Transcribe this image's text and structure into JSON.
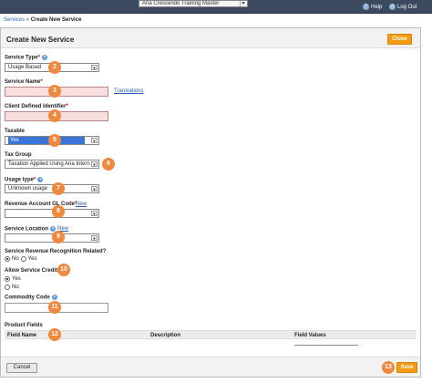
{
  "topbar": {
    "client_select": "Aria Crescendo Training Master",
    "help_label": "Help",
    "logout_label": "Log Out"
  },
  "breadcrumb": {
    "parent": "Services",
    "separator": "»",
    "current": "Create New Service"
  },
  "panel": {
    "title": "Create New Service",
    "close_label": "Close"
  },
  "form": {
    "service_type": {
      "label": "Service Type",
      "value": "Usage Based"
    },
    "service_name": {
      "label": "Service Name",
      "translations_link": "Translations",
      "value": ""
    },
    "client_defined_identifier": {
      "label": "Client Defined Identifier",
      "value": ""
    },
    "taxable": {
      "label": "Taxable",
      "value": "Yes"
    },
    "tax_group": {
      "label": "Tax Group",
      "value": "Taxation Applied Using Aria Intern"
    },
    "usage_type": {
      "label": "Usage type",
      "value": "Unknown usage"
    },
    "revenue_gl_code": {
      "label": "Revenue Account GL Code",
      "new_link": "New",
      "value": ""
    },
    "service_location": {
      "label": "Service Location",
      "new_link": "New",
      "value": ""
    },
    "revenue_recognition": {
      "label": "Service Revenue Recognition Related?",
      "no_label": "No",
      "yes_label": "Yes",
      "selected": "No"
    },
    "allow_credits": {
      "label": "Allow Service Credits",
      "yes_label": "Yes",
      "no_label": "No",
      "selected": "Yes"
    },
    "commodity_code": {
      "label": "Commodity Code",
      "value": ""
    }
  },
  "product_fields": {
    "title": "Product Fields",
    "columns": [
      "Field Name",
      "Description",
      "Field Values"
    ]
  },
  "footer": {
    "cancel_label": "Cancel",
    "save_label": "Save"
  },
  "callouts": [
    "1",
    "2",
    "3",
    "4",
    "5",
    "6",
    "7",
    "8",
    "9",
    "10",
    "11",
    "12",
    "13"
  ],
  "colors": {
    "topbar": "#3b4a5e",
    "accent_orange": "#f39c12",
    "callout": "#f0883e",
    "required_field": "#f8dede",
    "link": "#2a5ea8",
    "selected_option": "#3875d7"
  }
}
